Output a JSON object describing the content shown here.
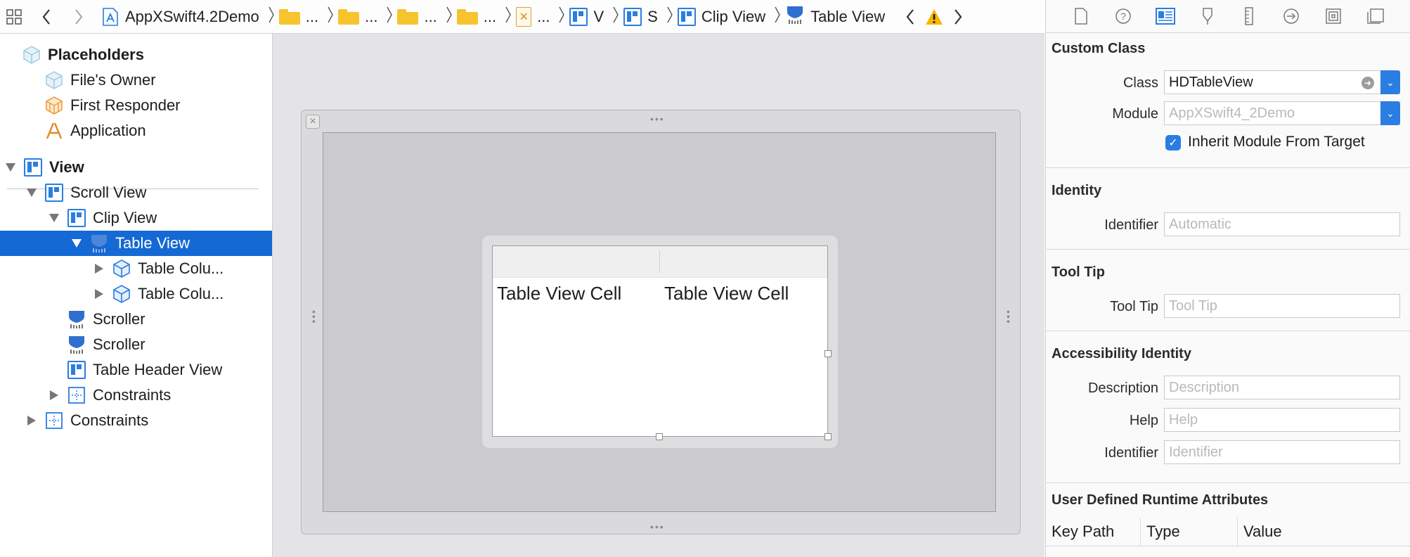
{
  "jumpbar": {
    "project": "AppXSwift4.2Demo",
    "ellipsis": "...",
    "seg_v": "V",
    "seg_s": "S",
    "clip_view": "Clip View",
    "table_view": "Table View"
  },
  "navigator": {
    "placeholders": "Placeholders",
    "files_owner": "File's Owner",
    "first_responder": "First Responder",
    "application": "Application",
    "view": "View",
    "scroll_view": "Scroll View",
    "clip_view": "Clip View",
    "table_view": "Table View",
    "table_column_1": "Table Colu...",
    "table_column_2": "Table Colu...",
    "scroller_1": "Scroller",
    "scroller_2": "Scroller",
    "table_header_view": "Table Header View",
    "constraints_1": "Constraints",
    "constraints_2": "Constraints"
  },
  "canvas": {
    "cell_1": "Table View Cell",
    "cell_2": "Table View Cell"
  },
  "inspector": {
    "custom_class": {
      "title": "Custom Class",
      "class_label": "Class",
      "class_value": "HDTableView",
      "module_label": "Module",
      "module_placeholder": "AppXSwift4_2Demo",
      "inherit_label": "Inherit Module From Target",
      "inherit_checked": true
    },
    "identity": {
      "title": "Identity",
      "identifier_label": "Identifier",
      "identifier_placeholder": "Automatic"
    },
    "tool_tip": {
      "title": "Tool Tip",
      "label": "Tool Tip",
      "placeholder": "Tool Tip"
    },
    "accessibility": {
      "title": "Accessibility Identity",
      "description_label": "Description",
      "description_placeholder": "Description",
      "help_label": "Help",
      "help_placeholder": "Help",
      "identifier_label": "Identifier",
      "identifier_placeholder": "Identifier"
    },
    "runtime": {
      "title": "User Defined Runtime Attributes",
      "col_key_path": "Key Path",
      "col_type": "Type",
      "col_value": "Value"
    }
  },
  "colors": {
    "accent": "#2a7de1",
    "selection": "#1469d4",
    "folder": "#f6c42f",
    "warning": "#f5b800"
  }
}
